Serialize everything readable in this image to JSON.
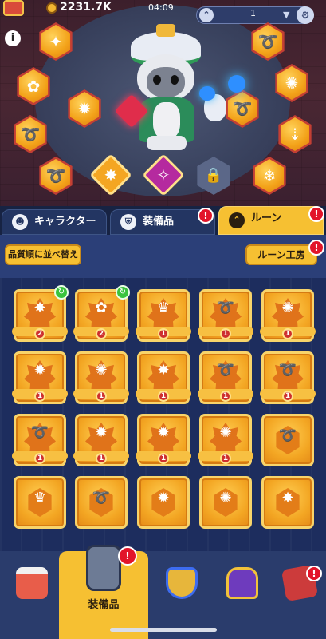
{
  "status": {
    "coins": "2231.7K",
    "time": "04:09",
    "floor": "1"
  },
  "rune_slots_left": [
    "✦",
    "✿",
    "✹",
    "➰",
    "➰"
  ],
  "rune_slots_right": [
    "➰",
    "✺",
    "➰",
    "⇣",
    "❄"
  ],
  "equipped_center": {
    "mid_slot": "✹",
    "special_gold": "✸",
    "special_purple": "✧",
    "lock": "🔒",
    "cross": "✛"
  },
  "tabs": [
    {
      "label": "キャラクター",
      "icon": "☻"
    },
    {
      "label": "装備品",
      "icon": "⛨",
      "badge": "!"
    },
    {
      "label": "ルーン",
      "icon": "⌃",
      "badge": "!"
    }
  ],
  "toolbar": {
    "sort_label": "品質順に並べ替え",
    "lab_label": "ルーン工房",
    "lab_badge": "!"
  },
  "grid": [
    {
      "glyph": "✸",
      "level": "2",
      "upgrade": "↻"
    },
    {
      "glyph": "✿",
      "level": "2",
      "upgrade": "↻"
    },
    {
      "glyph": "♛",
      "level": "1"
    },
    {
      "glyph": "➰",
      "level": "1"
    },
    {
      "glyph": "✺",
      "level": "1"
    },
    {
      "glyph": "✹",
      "level": "1"
    },
    {
      "glyph": "✺",
      "level": "1"
    },
    {
      "glyph": "✸",
      "level": "1"
    },
    {
      "glyph": "➰",
      "level": "1"
    },
    {
      "glyph": "➰",
      "level": "1"
    },
    {
      "glyph": "➰",
      "level": "1"
    },
    {
      "glyph": "✹",
      "level": "1"
    },
    {
      "glyph": "✹",
      "level": "1"
    },
    {
      "glyph": "✺",
      "level": "1"
    },
    {
      "glyph": "➰",
      "plain": true
    },
    {
      "glyph": "♛",
      "plain": true
    },
    {
      "glyph": "➰",
      "plain": true
    },
    {
      "glyph": "✹",
      "plain": true
    },
    {
      "glyph": "✺",
      "plain": true
    },
    {
      "glyph": "✸",
      "plain": true
    }
  ],
  "nav": [
    {
      "name": "shop"
    },
    {
      "name": "equipment",
      "label": "装備品",
      "badge": "!"
    },
    {
      "name": "battle"
    },
    {
      "name": "trophy"
    },
    {
      "name": "mail",
      "badge": "!"
    }
  ]
}
